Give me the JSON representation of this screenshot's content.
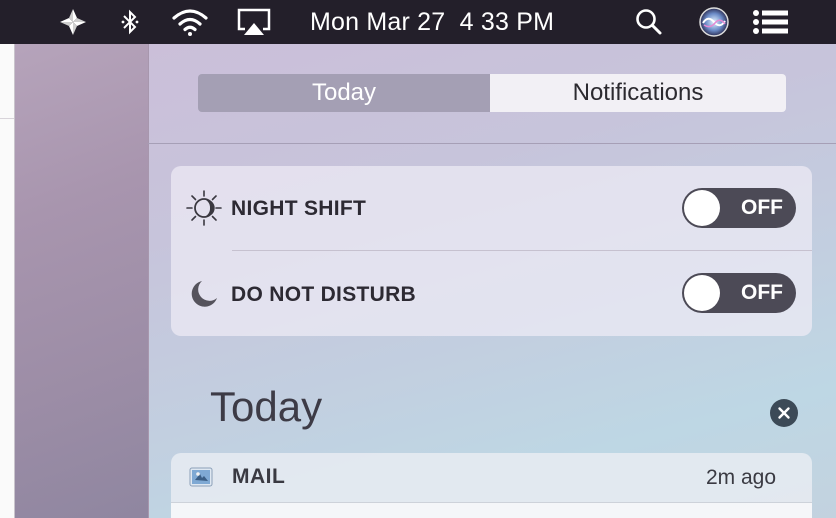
{
  "menubar": {
    "datetime": "Mon Mar 27  4 33 PM",
    "icons": [
      "pinwheel-icon",
      "bluetooth-icon",
      "wifi-icon",
      "airplay-icon",
      "spotlight-search-icon",
      "siri-icon",
      "notification-center-icon"
    ]
  },
  "tabs": [
    {
      "label": "Today",
      "active": true
    },
    {
      "label": "Notifications",
      "active": false
    }
  ],
  "toggles": [
    {
      "label": "NIGHT SHIFT",
      "state": "OFF",
      "icon": "night-shift-icon"
    },
    {
      "label": "DO NOT DISTURB",
      "state": "OFF",
      "icon": "moon-icon"
    }
  ],
  "today": {
    "heading": "Today",
    "clear_icon": "close-circle-icon"
  },
  "notification": {
    "app": "MAIL",
    "time": "2m ago",
    "icon": "mail-app-icon"
  },
  "colors": {
    "menubar": "#231f2a",
    "active_tab": "#a49fb4",
    "toggle_track": "#4c4a56"
  }
}
